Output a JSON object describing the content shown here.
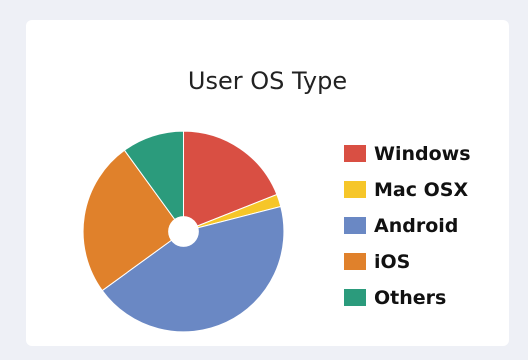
{
  "chart_data": {
    "type": "pie",
    "title": "User OS Type",
    "categories": [
      "Windows",
      "Mac OSX",
      "Android",
      "iOS",
      "Others"
    ],
    "values": [
      19,
      2,
      44,
      25,
      10
    ],
    "colors": [
      "#d94f43",
      "#f6c629",
      "#6a88c4",
      "#e0812b",
      "#2b9b7c"
    ],
    "start_angle_deg": 0,
    "legend_position": "right"
  }
}
